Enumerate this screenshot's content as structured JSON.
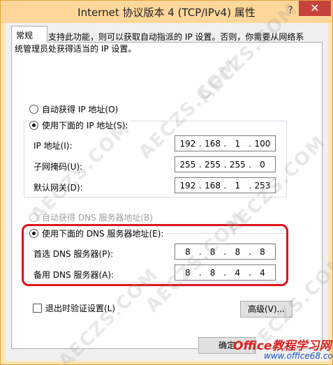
{
  "window": {
    "title": "Internet 协议版本 4 (TCP/IPv4) 属性",
    "help_glyph": "?",
    "close_glyph": "✕"
  },
  "tabs": [
    {
      "label": "常规"
    }
  ],
  "description": "如果网络支持此功能，则可以获取自动指派的 IP 设置。否则，你需要从网络系统管理员处获得适当的 IP 设置。",
  "ip_section": {
    "auto_label": "自动获得 IP 地址(O)",
    "manual_label": "使用下面的 IP 地址(S):",
    "selected": "manual",
    "fields": [
      {
        "label": "IP 地址(I):",
        "value": [
          "192",
          "168",
          "1",
          "100"
        ]
      },
      {
        "label": "子网掩码(U):",
        "value": [
          "255",
          "255",
          "255",
          "0"
        ]
      },
      {
        "label": "默认网关(D):",
        "value": [
          "192",
          "168",
          "1",
          "253"
        ]
      }
    ]
  },
  "dns_section": {
    "auto_label": "自动获得 DNS 服务器地址(B)",
    "manual_label": "使用下面的 DNS 服务器地址(E):",
    "selected": "manual",
    "fields": [
      {
        "label": "首选 DNS 服务器(P):",
        "value": [
          "8",
          "8",
          "8",
          "8"
        ]
      },
      {
        "label": "备用 DNS 服务器(A):",
        "value": [
          "8",
          "8",
          "4",
          "4"
        ]
      }
    ]
  },
  "validate_label": "退出时验证设置(L)",
  "advanced_label": "高级(V)...",
  "ok_label": "确定",
  "watermark_text": "AECZS.COM",
  "brand": {
    "name": "Office教程学习网",
    "url": "www.office68.com"
  },
  "colors": {
    "title_bar": "#ffd79a",
    "close_button": "#c7423b",
    "highlight": "#e0131b",
    "brand_red": "#e02020",
    "brand_blue": "#1a55c8"
  }
}
